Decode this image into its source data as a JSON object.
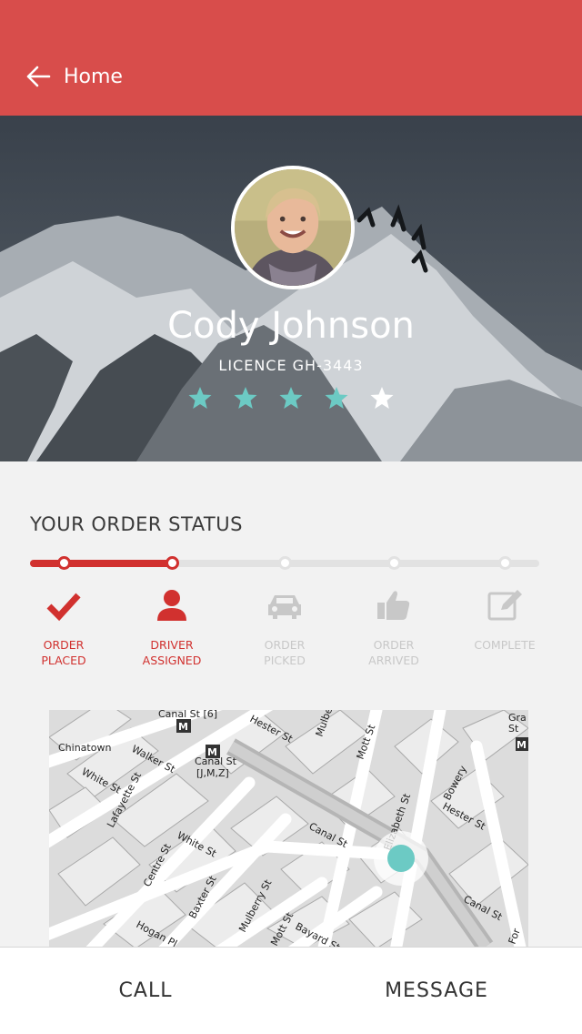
{
  "header": {
    "back_label": "Home",
    "color": "#d84d4b"
  },
  "driver": {
    "name": "Cody Johnson",
    "licence": "LICENCE GH-3443",
    "rating": 4,
    "rating_max": 5,
    "star_color": "#6ccac4"
  },
  "order_status": {
    "title": "YOUR ORDER STATUS",
    "progress_steps_completed": 2,
    "steps": [
      {
        "label": "ORDER\nPLACED",
        "icon": "checkmark-icon",
        "done": true
      },
      {
        "label": "DRIVER\nASSIGNED",
        "icon": "person-icon",
        "done": true
      },
      {
        "label": "ORDER\nPICKED",
        "icon": "car-icon",
        "done": false
      },
      {
        "label": "ORDER\nARRIVED",
        "icon": "thumbs-up-icon",
        "done": false
      },
      {
        "label": "COMPLETE",
        "icon": "edit-icon",
        "done": false
      }
    ],
    "accent": "#d1312f"
  },
  "map": {
    "streets": [
      "Canal St",
      "Hester St",
      "Walker St",
      "White St",
      "Lafayette St",
      "Centre St",
      "Baxter St",
      "Mulberry St",
      "Mott St",
      "Bayard St",
      "Hogan Pl",
      "Elizabeth St",
      "Bowery",
      "Hester St",
      "Canal St",
      "Chinatown",
      "Canal St [J,M,Z]",
      "Mulbe",
      "Mott St",
      "Gra St",
      "Canal St [6]",
      "White St",
      "For"
    ],
    "marker_color": "#6ccac4"
  },
  "actions": {
    "call_label": "CALL",
    "message_label": "MESSAGE"
  }
}
